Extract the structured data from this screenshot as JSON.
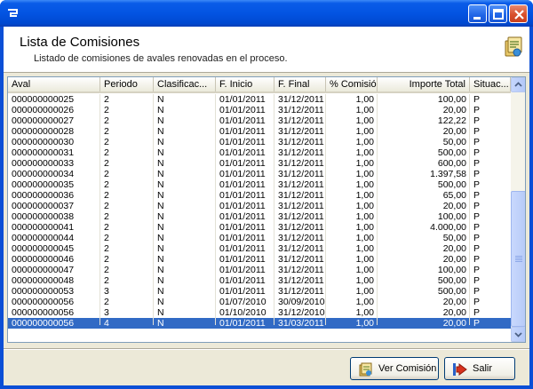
{
  "window": {
    "colors": {
      "titlebar": "#0054e3",
      "selection": "#316ac5",
      "face": "#ece9d8"
    }
  },
  "header": {
    "title": "Lista de Comisiones",
    "subtitle": "Listado de comisiones de avales renovadas en el proceso.",
    "icon": "commissions-icon"
  },
  "grid": {
    "columns": [
      "Aval",
      "Periodo",
      "Clasificac...",
      "F. Inicio",
      "F. Final",
      "% Comisión",
      "Importe Total",
      "Situac..."
    ],
    "rows": [
      [
        "000000000025",
        "2",
        "N",
        "01/01/2011",
        "31/12/2011",
        "1,00",
        "100,00",
        "P"
      ],
      [
        "000000000026",
        "2",
        "N",
        "01/01/2011",
        "31/12/2011",
        "1,00",
        "20,00",
        "P"
      ],
      [
        "000000000027",
        "2",
        "N",
        "01/01/2011",
        "31/12/2011",
        "1,00",
        "122,22",
        "P"
      ],
      [
        "000000000028",
        "2",
        "N",
        "01/01/2011",
        "31/12/2011",
        "1,00",
        "20,00",
        "P"
      ],
      [
        "000000000030",
        "2",
        "N",
        "01/01/2011",
        "31/12/2011",
        "1,00",
        "50,00",
        "P"
      ],
      [
        "000000000031",
        "2",
        "N",
        "01/01/2011",
        "31/12/2011",
        "1,00",
        "500,00",
        "P"
      ],
      [
        "000000000033",
        "2",
        "N",
        "01/01/2011",
        "31/12/2011",
        "1,00",
        "600,00",
        "P"
      ],
      [
        "000000000034",
        "2",
        "N",
        "01/01/2011",
        "31/12/2011",
        "1,00",
        "1.397,58",
        "P"
      ],
      [
        "000000000035",
        "2",
        "N",
        "01/01/2011",
        "31/12/2011",
        "1,00",
        "500,00",
        "P"
      ],
      [
        "000000000036",
        "2",
        "N",
        "01/01/2011",
        "31/12/2011",
        "1,00",
        "65,00",
        "P"
      ],
      [
        "000000000037",
        "2",
        "N",
        "01/01/2011",
        "31/12/2011",
        "1,00",
        "20,00",
        "P"
      ],
      [
        "000000000038",
        "2",
        "N",
        "01/01/2011",
        "31/12/2011",
        "1,00",
        "100,00",
        "P"
      ],
      [
        "000000000041",
        "2",
        "N",
        "01/01/2011",
        "31/12/2011",
        "1,00",
        "4.000,00",
        "P"
      ],
      [
        "000000000044",
        "2",
        "N",
        "01/01/2011",
        "31/12/2011",
        "1,00",
        "50,00",
        "P"
      ],
      [
        "000000000045",
        "2",
        "N",
        "01/01/2011",
        "31/12/2011",
        "1,00",
        "20,00",
        "P"
      ],
      [
        "000000000046",
        "2",
        "N",
        "01/01/2011",
        "31/12/2011",
        "1,00",
        "20,00",
        "P"
      ],
      [
        "000000000047",
        "2",
        "N",
        "01/01/2011",
        "31/12/2011",
        "1,00",
        "100,00",
        "P"
      ],
      [
        "000000000048",
        "2",
        "N",
        "01/01/2011",
        "31/12/2011",
        "1,00",
        "500,00",
        "P"
      ],
      [
        "000000000053",
        "3",
        "N",
        "01/01/2011",
        "31/12/2011",
        "1,00",
        "500,00",
        "P"
      ],
      [
        "000000000056",
        "2",
        "N",
        "01/07/2010",
        "30/09/2010",
        "1,00",
        "20,00",
        "P"
      ],
      [
        "000000000056",
        "3",
        "N",
        "01/10/2010",
        "31/12/2010",
        "1,00",
        "20,00",
        "P"
      ],
      [
        "000000000056",
        "4",
        "N",
        "01/01/2011",
        "31/03/2011",
        "1,00",
        "20,00",
        "P"
      ]
    ],
    "selected_row": 21
  },
  "buttons": {
    "view": {
      "label": "Ver Comisión",
      "icon": "view-commission-icon"
    },
    "exit": {
      "label": "Salir",
      "icon": "exit-arrow-icon"
    }
  }
}
